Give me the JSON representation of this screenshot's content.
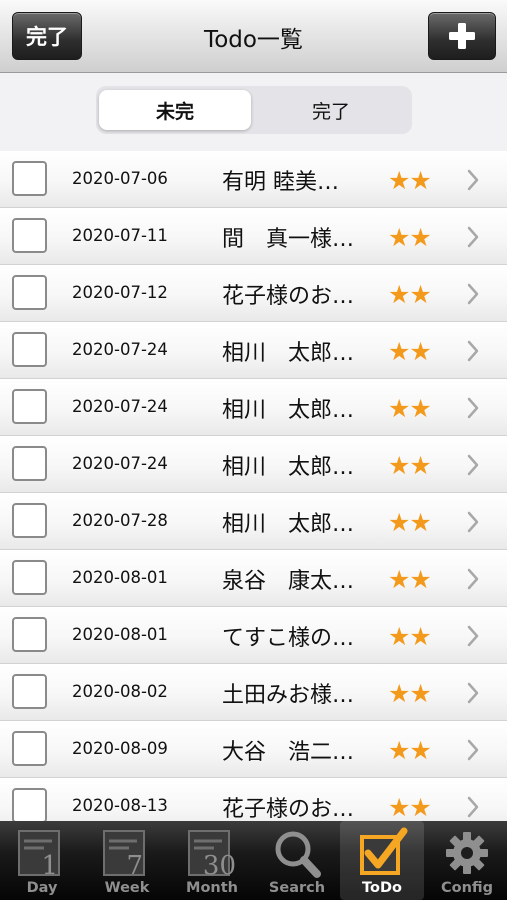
{
  "navbar": {
    "title": "Todo一覧",
    "done_label": "完了",
    "add_icon": "plus-icon"
  },
  "segment": {
    "left_label": "未完",
    "right_label": "完了",
    "selected": "未完"
  },
  "todos": [
    {
      "date": "2020-07-06",
      "title": "有明 睦美…",
      "stars": "★★"
    },
    {
      "date": "2020-07-11",
      "title": "間　真一様…",
      "stars": "★★"
    },
    {
      "date": "2020-07-12",
      "title": "花子様のお…",
      "stars": "★★"
    },
    {
      "date": "2020-07-24",
      "title": "相川　太郎…",
      "stars": "★★"
    },
    {
      "date": "2020-07-24",
      "title": "相川　太郎…",
      "stars": "★★"
    },
    {
      "date": "2020-07-24",
      "title": "相川　太郎…",
      "stars": "★★"
    },
    {
      "date": "2020-07-28",
      "title": "相川　太郎…",
      "stars": "★★"
    },
    {
      "date": "2020-08-01",
      "title": "泉谷　康太…",
      "stars": "★★"
    },
    {
      "date": "2020-08-01",
      "title": "てすこ様の…",
      "stars": "★★"
    },
    {
      "date": "2020-08-02",
      "title": "土田みお様…",
      "stars": "★★"
    },
    {
      "date": "2020-08-09",
      "title": "大谷　浩二…",
      "stars": "★★"
    },
    {
      "date": "2020-08-13",
      "title": "花子様のお…",
      "stars": "★★"
    }
  ],
  "tabbar": {
    "tabs": [
      {
        "label": "Day",
        "icon_number": "1"
      },
      {
        "label": "Week",
        "icon_number": "7"
      },
      {
        "label": "Month",
        "icon_number": "30"
      },
      {
        "label": "Search"
      },
      {
        "label": "ToDo"
      },
      {
        "label": "Config"
      }
    ],
    "active": "ToDo"
  },
  "colors": {
    "star": "#f39a1c",
    "active_tab_icon": "#f5a623"
  }
}
